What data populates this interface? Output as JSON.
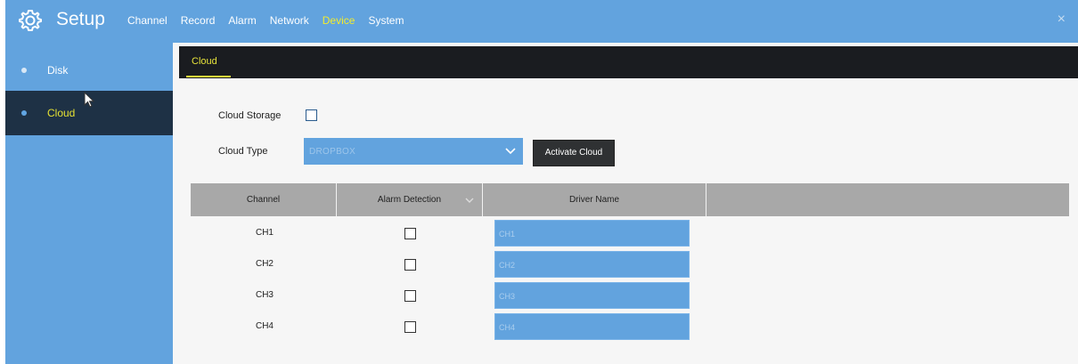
{
  "app": {
    "title": "Setup",
    "menu": [
      {
        "label": "Channel",
        "active": false
      },
      {
        "label": "Record",
        "active": false
      },
      {
        "label": "Alarm",
        "active": false
      },
      {
        "label": "Network",
        "active": false
      },
      {
        "label": "Device",
        "active": true
      },
      {
        "label": "System",
        "active": false
      }
    ],
    "close_glyph": "×"
  },
  "sidebar": {
    "items": [
      {
        "label": "Disk",
        "active": false
      },
      {
        "label": "Cloud",
        "active": true
      }
    ]
  },
  "subtabs": [
    {
      "label": "Cloud",
      "active": true
    }
  ],
  "form": {
    "cloud_storage_label": "Cloud Storage",
    "cloud_storage_checked": false,
    "cloud_type_label": "Cloud Type",
    "cloud_type_value": "DROPBOX",
    "activate_button": "Activate Cloud"
  },
  "table": {
    "headers": [
      "Channel",
      "Alarm Detection",
      "Driver Name"
    ],
    "rows": [
      {
        "channel": "CH1",
        "alarm": false,
        "driver_name": "CH1"
      },
      {
        "channel": "CH2",
        "alarm": false,
        "driver_name": "CH2"
      },
      {
        "channel": "CH3",
        "alarm": false,
        "driver_name": "CH3"
      },
      {
        "channel": "CH4",
        "alarm": false,
        "driver_name": "CH4"
      }
    ]
  },
  "icons": {
    "logo": "gear-icon",
    "close": "close-icon",
    "dropdown": "chevron-down-icon",
    "cursor": "mouse-pointer-icon"
  },
  "colors": {
    "bar_blue": "#62a3de",
    "active_yellow": "#f3ec2c",
    "dark": "#1a1c20",
    "header_grey": "#a8a8a8"
  }
}
